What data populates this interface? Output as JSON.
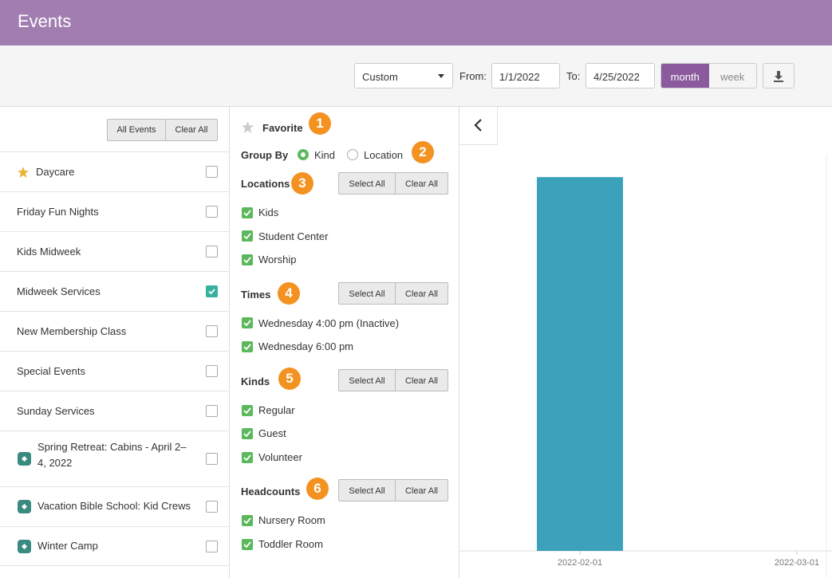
{
  "header": {
    "title": "Events"
  },
  "toolbar": {
    "range_select": "Custom",
    "from_label": "From:",
    "from_value": "1/1/2022",
    "to_label": "To:",
    "to_value": "4/25/2022",
    "view_modes": [
      "month",
      "week"
    ],
    "active_view": "month",
    "download_icon": "download-icon"
  },
  "left_panel": {
    "all_events_label": "All Events",
    "clear_all_label": "Clear All",
    "events": [
      {
        "label": "Daycare",
        "icon": "star-icon",
        "checked": false
      },
      {
        "label": "Friday Fun Nights",
        "checked": false
      },
      {
        "label": "Kids Midweek",
        "checked": false
      },
      {
        "label": "Midweek Services",
        "checked": true
      },
      {
        "label": "New Membership Class",
        "checked": false
      },
      {
        "label": "Special Events",
        "checked": false
      },
      {
        "label": "Sunday Services",
        "checked": false
      },
      {
        "label_line1": "Spring Retreat: Cabins - April 2–",
        "label_line2": "4, 2022",
        "icon": "ticket-icon",
        "checked": false
      },
      {
        "label": "Vacation Bible School: Kid Crews",
        "icon": "ticket-icon",
        "checked": false
      },
      {
        "label": "Winter Camp",
        "icon": "ticket-icon",
        "checked": false
      }
    ]
  },
  "filters": {
    "favorite_label": "Favorite",
    "group_by": {
      "label": "Group By",
      "options": [
        "Kind",
        "Location"
      ],
      "selected": "Kind"
    },
    "select_all_label": "Select All",
    "clear_all_label": "Clear All",
    "badges": [
      "1",
      "2",
      "3",
      "4",
      "5",
      "6"
    ],
    "locations": {
      "title": "Locations",
      "items": [
        "Kids",
        "Student Center",
        "Worship"
      ]
    },
    "times": {
      "title": "Times",
      "items": [
        "Wednesday 4:00 pm (Inactive)",
        "Wednesday 6:00 pm"
      ]
    },
    "kinds": {
      "title": "Kinds",
      "items": [
        "Regular",
        "Guest",
        "Volunteer"
      ]
    },
    "headcounts": {
      "title": "Headcounts",
      "items": [
        "Nursery Room",
        "Toddler Room"
      ]
    }
  },
  "colors": {
    "header": "#a17db0",
    "accent": "#8a5a9c",
    "bar": "#3ca2bc",
    "badge": "#f39220",
    "check": "#5cb85c"
  },
  "chart_data": {
    "type": "bar",
    "x": [
      "2022-02-01",
      "2022-03-01"
    ],
    "tick_labels": [
      "2022-02-01",
      "2022-03-01"
    ],
    "bars": [
      {
        "x": "2022-02-01",
        "value": 1
      }
    ],
    "ylim": [
      0,
      1.06
    ],
    "grid": false,
    "legend": "none"
  }
}
